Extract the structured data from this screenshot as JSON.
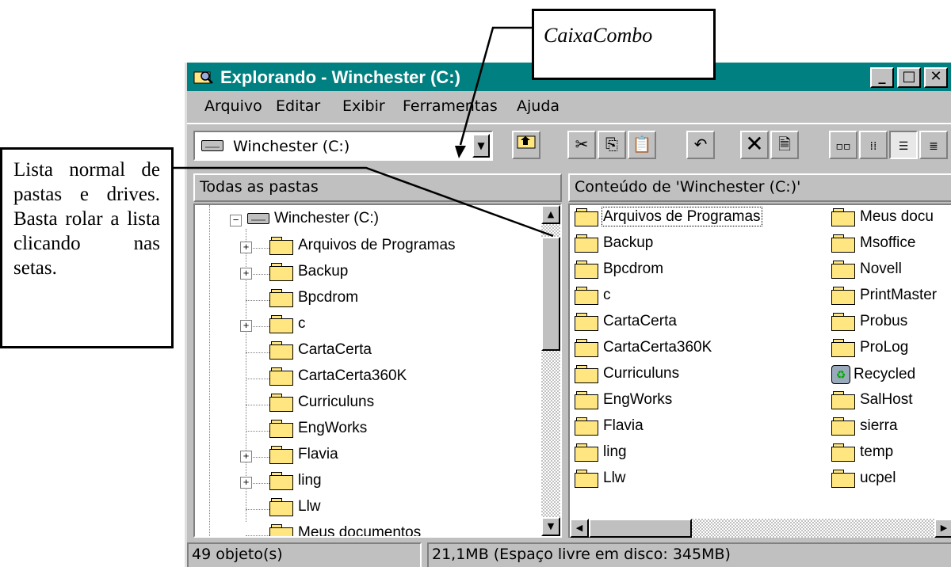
{
  "window": {
    "title": "Explorando - Winchester (C:)",
    "minimize": "_",
    "maximize": "□",
    "close": "✕"
  },
  "menu": [
    "Arquivo",
    "Editar",
    "Exibir",
    "Ferramentas",
    "Ajuda"
  ],
  "combo": {
    "value": "Winchester (C:)",
    "arrow": "▼"
  },
  "headers": {
    "left": "Todas as pastas",
    "right": "Conteúdo de 'Winchester (C:)'"
  },
  "tree": {
    "root": "Winchester (C:)",
    "items": [
      {
        "label": "Arquivos de Programas",
        "expand": "+"
      },
      {
        "label": "Backup",
        "expand": "+"
      },
      {
        "label": "Bpcdrom",
        "expand": ""
      },
      {
        "label": "c",
        "expand": "+"
      },
      {
        "label": "CartaCerta",
        "expand": ""
      },
      {
        "label": "CartaCerta360K",
        "expand": ""
      },
      {
        "label": "Curriculuns",
        "expand": ""
      },
      {
        "label": "EngWorks",
        "expand": ""
      },
      {
        "label": "Flavia",
        "expand": "+"
      },
      {
        "label": "ling",
        "expand": "+"
      },
      {
        "label": "Llw",
        "expand": ""
      },
      {
        "label": "Meus documentos",
        "expand": ""
      }
    ]
  },
  "contents": {
    "col1": [
      "Arquivos de Programas",
      "Backup",
      "Bpcdrom",
      "c",
      "CartaCerta",
      "CartaCerta360K",
      "Curriculuns",
      "EngWorks",
      "Flavia",
      "ling",
      "Llw"
    ],
    "col2": [
      "Meus docu",
      "Msoffice",
      "Novell",
      "PrintMaster",
      "Probus",
      "ProLog",
      "Recycled",
      "SalHost",
      "sierra",
      "temp",
      "ucpel"
    ]
  },
  "status": {
    "count": "49 objeto(s)",
    "size": "21,1MB (Espaço livre em disco: 345MB)"
  },
  "callouts": {
    "combo": "CaixaCombo",
    "list": "Lista normal de pastas e drives. Basta rolar a lista clicando nas setas."
  },
  "icons": {
    "explorer": "explorer-window-icon",
    "folder": "folder-icon",
    "drive": "drive-icon",
    "recycle": "recycle-bin-icon"
  }
}
